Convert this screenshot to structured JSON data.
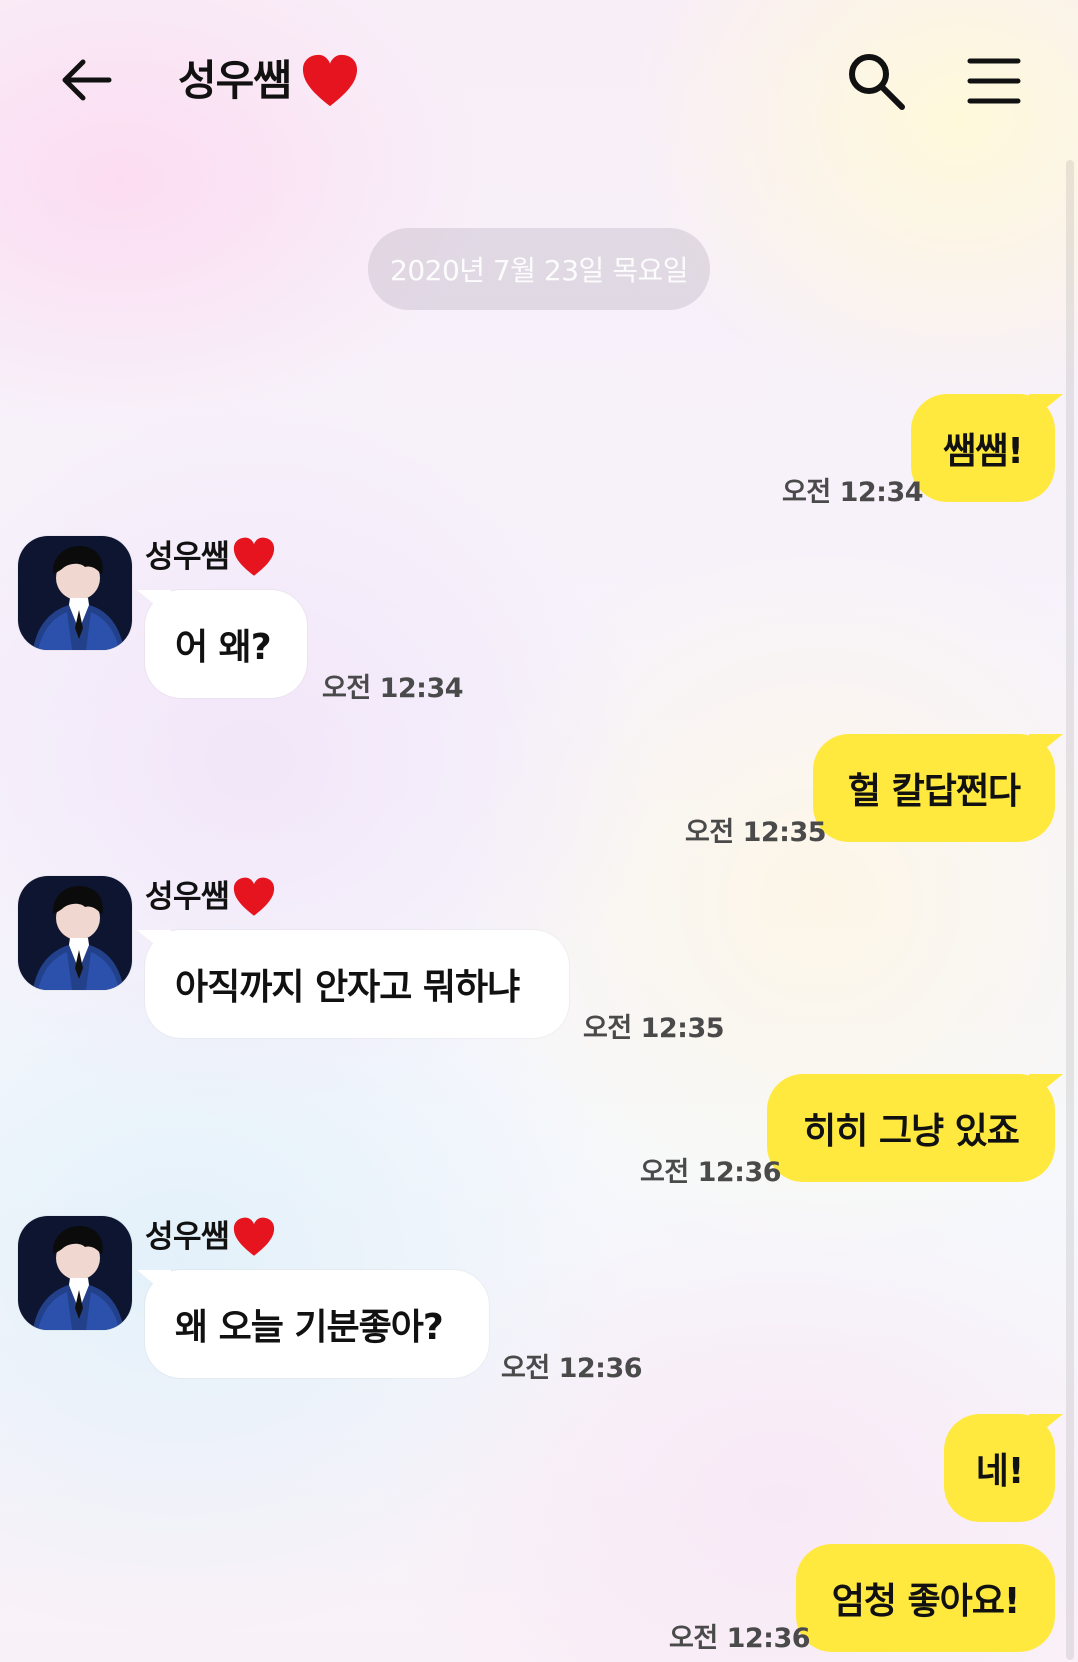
{
  "header": {
    "title": "성우쌤❤️",
    "title_text": "성우쌤",
    "back_icon": "back-arrow-icon",
    "search_icon": "search-icon",
    "menu_icon": "menu-icon"
  },
  "conversation": {
    "date": "2020년 7월 23일 목요일",
    "messages": [
      {
        "side": "out",
        "text": "쌤쌤!",
        "time": "오전 12:34"
      },
      {
        "side": "in",
        "sender": "성우쌤",
        "text": "어 왜?",
        "time": "오전 12:34"
      },
      {
        "side": "out",
        "text": "헐 칼답쩐다",
        "time": "오전 12:35"
      },
      {
        "side": "in",
        "sender": "성우쌤",
        "text": "아직까지 안자고 뭐하냐",
        "time": "오전 12:35"
      },
      {
        "side": "out",
        "text": "히히 그냥 있죠",
        "time": "오전 12:36"
      },
      {
        "side": "in",
        "sender": "성우쌤",
        "text": "왜 오늘 기분좋아?",
        "time": "오전 12:36"
      },
      {
        "side": "out",
        "text": "네!",
        "time": ""
      },
      {
        "side": "out",
        "text": "엄청 좋아요!",
        "time": "오전 12:36"
      }
    ]
  },
  "colors": {
    "outgoing_bubble": "#ffe93f",
    "incoming_bubble": "#ffffff",
    "heart": "#e5141e",
    "date_pill": "#b8b1b9"
  }
}
